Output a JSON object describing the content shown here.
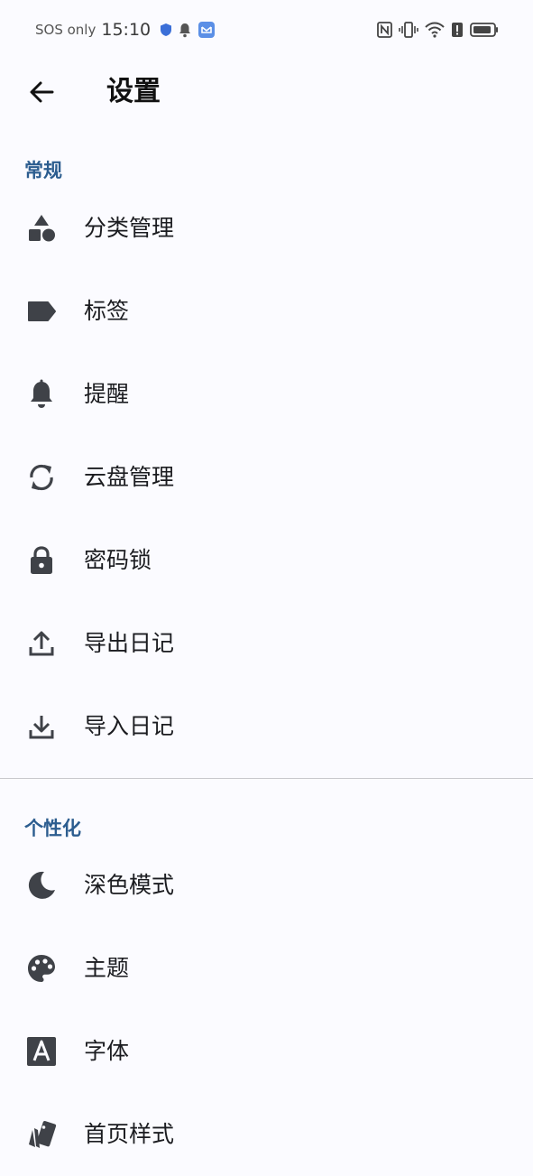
{
  "status_bar": {
    "carrier": "SOS only",
    "time": "15:10",
    "icons": [
      "shield-icon",
      "bell-icon",
      "app-notification-icon",
      "nfc-icon",
      "vibrate-icon",
      "wifi-icon",
      "alert-icon",
      "battery-icon"
    ]
  },
  "app_bar": {
    "title": "设置",
    "back_icon": "arrow-back-icon"
  },
  "sections": [
    {
      "header": "常规",
      "items": [
        {
          "label": "分类管理",
          "icon": "category-icon"
        },
        {
          "label": "标签",
          "icon": "label-tag-icon"
        },
        {
          "label": "提醒",
          "icon": "bell-icon"
        },
        {
          "label": "云盘管理",
          "icon": "sync-icon"
        },
        {
          "label": "密码锁",
          "icon": "lock-icon"
        },
        {
          "label": "导出日记",
          "icon": "upload-icon"
        },
        {
          "label": "导入日记",
          "icon": "download-icon"
        }
      ]
    },
    {
      "header": "个性化",
      "items": [
        {
          "label": "深色模式",
          "icon": "dark-mode-moon-icon"
        },
        {
          "label": "主题",
          "icon": "palette-icon"
        },
        {
          "label": "字体",
          "icon": "font-a-icon"
        },
        {
          "label": "首页样式",
          "icon": "style-cards-icon"
        }
      ]
    }
  ],
  "colors": {
    "background": "#fbfbff",
    "section_header": "#2c5d8f",
    "text": "#1b1c20",
    "icon": "#3f4248",
    "divider": "#c8c8cc"
  }
}
